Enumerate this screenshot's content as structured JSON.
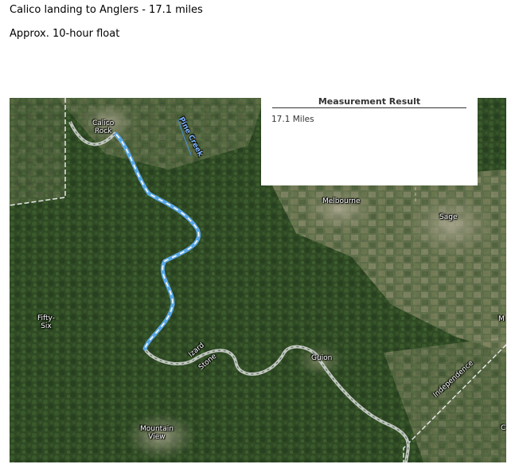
{
  "document": {
    "title": "Calico landing to Anglers - 17.1 miles",
    "subtitle": "Approx. 10-hour float"
  },
  "map": {
    "measurement_panel": {
      "title": "Measurement Result",
      "value": "17.1 Miles"
    },
    "labels": {
      "calico_rock": [
        "Calico",
        "Rock"
      ],
      "piney_creek": "Pine Creek",
      "melbourne": "Melbourne",
      "sage": "Sage",
      "fifty_six": [
        "Fifty-",
        "Six"
      ],
      "mountain_view": [
        "Mountain",
        "View"
      ],
      "izard": "Izard",
      "stone": "Stone",
      "guion": "Guion",
      "independence": "Independence",
      "edge_m": "M",
      "edge_c": "C"
    },
    "colors": {
      "forest": "#2f4a24",
      "farmland": "#6d7a58",
      "river": "#cfd6d0",
      "measure_line": "#5aa8e8",
      "boundary": "#e8e8e8"
    }
  }
}
